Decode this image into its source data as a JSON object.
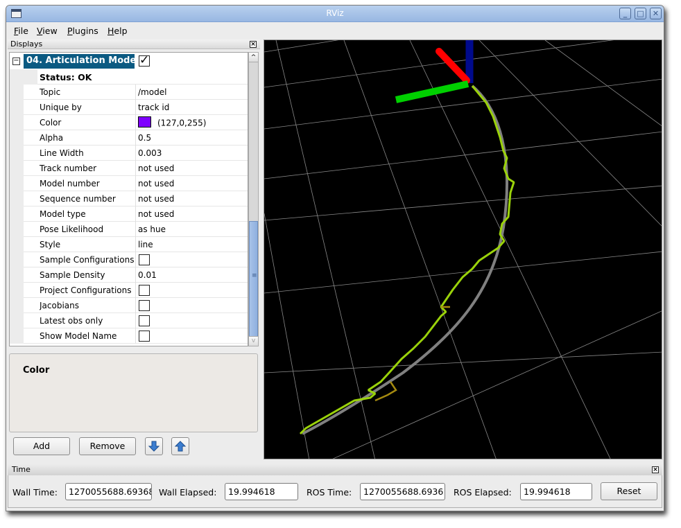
{
  "window": {
    "title": "RViz"
  },
  "menu": [
    "File",
    "View",
    "Plugins",
    "Help"
  ],
  "displays_panel": {
    "title": "Displays",
    "display": {
      "name": "04. Articulation Mode",
      "enabled": true,
      "status": "Status: OK"
    },
    "properties": [
      {
        "name": "Topic",
        "value": "/model",
        "type": "text"
      },
      {
        "name": "Unique by",
        "value": "track id",
        "type": "text"
      },
      {
        "name": "Color",
        "value": "(127,0,255)",
        "type": "color",
        "swatch": "#7f00ff"
      },
      {
        "name": "Alpha",
        "value": "0.5",
        "type": "text"
      },
      {
        "name": "Line Width",
        "value": "0.003",
        "type": "text"
      },
      {
        "name": "Track number",
        "value": "not used",
        "type": "text"
      },
      {
        "name": "Model number",
        "value": "not used",
        "type": "text"
      },
      {
        "name": "Sequence number",
        "value": "not used",
        "type": "text"
      },
      {
        "name": "Model type",
        "value": "not used",
        "type": "text"
      },
      {
        "name": "Pose Likelihood",
        "value": "as hue",
        "type": "text"
      },
      {
        "name": "Style",
        "value": "line",
        "type": "text"
      },
      {
        "name": "Sample Configurations",
        "checked": false,
        "type": "checkbox"
      },
      {
        "name": "Sample Density",
        "value": "0.01",
        "type": "text"
      },
      {
        "name": "Project Configurations",
        "checked": false,
        "type": "checkbox"
      },
      {
        "name": "Jacobians",
        "checked": false,
        "type": "checkbox"
      },
      {
        "name": "Latest obs only",
        "checked": false,
        "type": "checkbox"
      },
      {
        "name": "Show Model Name",
        "checked": false,
        "type": "checkbox"
      }
    ],
    "description_title": "Color",
    "buttons": {
      "add": "Add",
      "remove": "Remove"
    }
  },
  "time_panel": {
    "title": "Time",
    "wall_time_label": "Wall Time:",
    "wall_time": "1270055688.69368",
    "wall_elapsed_label": "Wall Elapsed:",
    "wall_elapsed": "19.994618",
    "ros_time_label": "ROS Time:",
    "ros_time": "1270055688.6936",
    "ros_elapsed_label": "ROS Elapsed:",
    "ros_elapsed": "19.994618",
    "reset_label": "Reset"
  },
  "colors": {
    "selection": "#0b5a82",
    "axis_x": "#ff0000",
    "axis_y": "#00d000",
    "axis_z": "#000a8c",
    "model_curve": "#808080",
    "trajectory": "#9ad20a"
  }
}
